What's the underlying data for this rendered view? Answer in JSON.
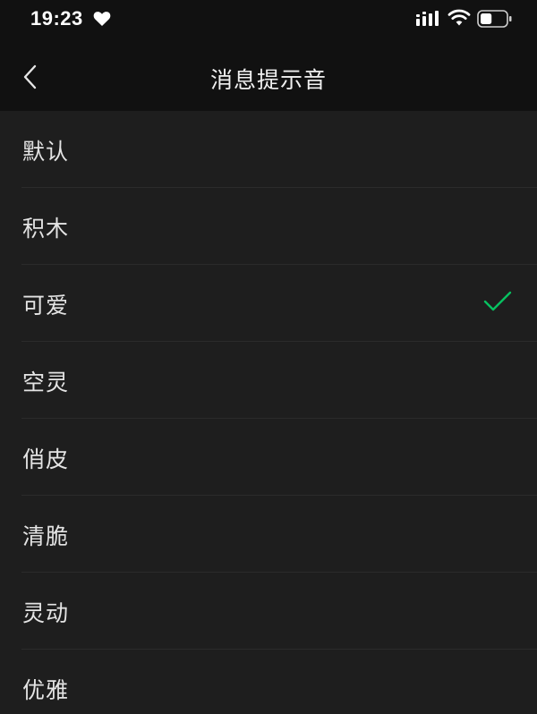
{
  "status_bar": {
    "time": "19:23",
    "icons": [
      "heart-icon",
      "signal-icon",
      "wifi-icon",
      "battery-icon"
    ],
    "battery_level": 0.45
  },
  "nav": {
    "title": "消息提示音",
    "back_icon": "chevron-left-icon"
  },
  "sounds": {
    "items": [
      {
        "label": "默认",
        "selected": false
      },
      {
        "label": "积木",
        "selected": false
      },
      {
        "label": "可爱",
        "selected": true
      },
      {
        "label": "空灵",
        "selected": false
      },
      {
        "label": "俏皮",
        "selected": false
      },
      {
        "label": "清脆",
        "selected": false
      },
      {
        "label": "灵动",
        "selected": false
      },
      {
        "label": "优雅",
        "selected": false
      }
    ],
    "check_icon": "checkmark-icon"
  },
  "colors": {
    "background": "#111111",
    "list_background": "#1e1e1e",
    "accent": "#07c160"
  }
}
